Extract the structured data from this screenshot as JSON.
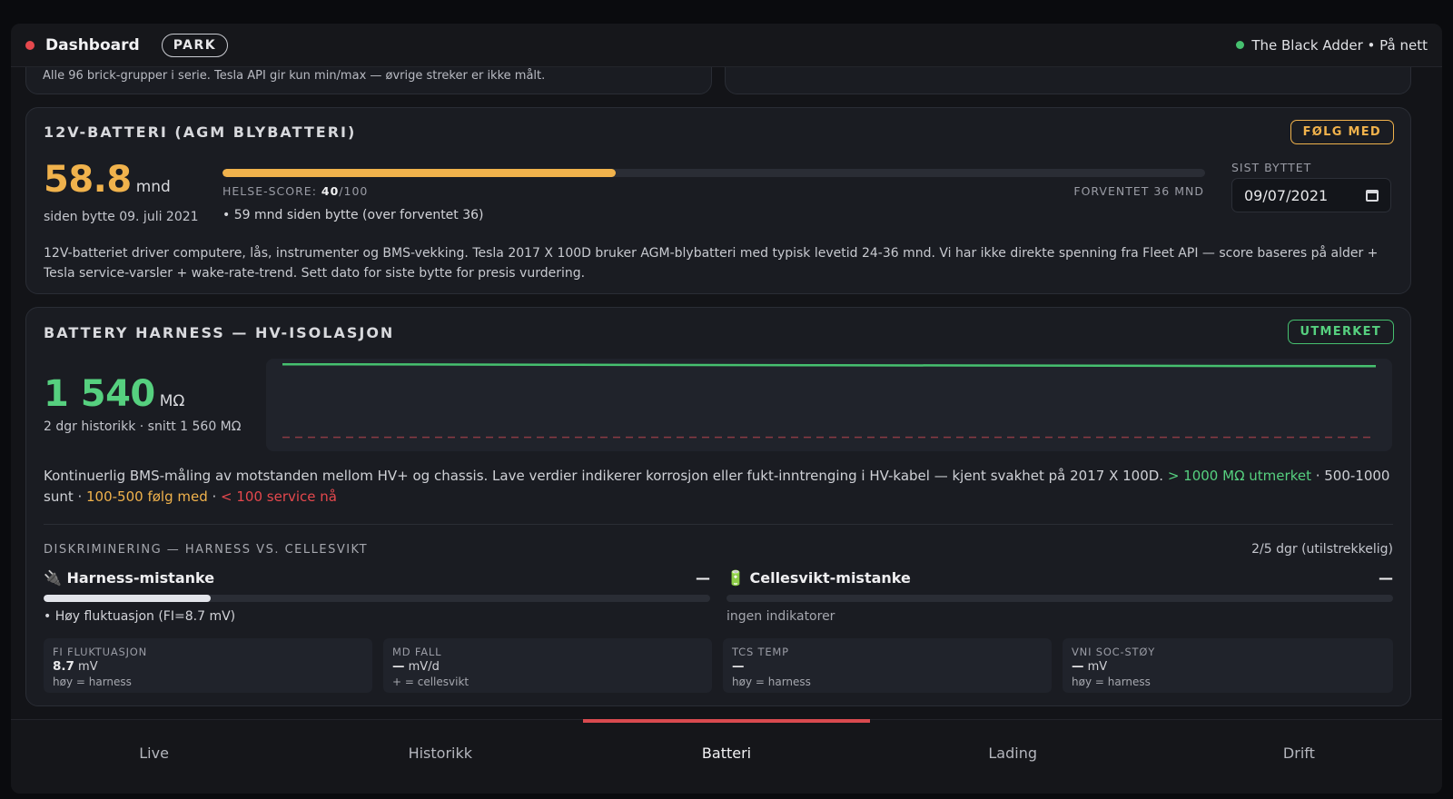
{
  "topbar": {
    "title": "Dashboard",
    "mode_badge": "PARK",
    "vehicle_status": "The Black Adder • På nett"
  },
  "cells_card": {
    "note": "Alle 96 brick-grupper i serie. Tesla API gir kun min/max — øvrige streker er ikke målt."
  },
  "battery12v": {
    "title": "12V-BATTERI (AGM BLYBATTERI)",
    "status_badge": "FØLG MED",
    "age_value": "58.8",
    "age_unit": "mnd",
    "since_label": "siden bytte 09. juli 2021",
    "health_label": "HELSE-SCORE: ",
    "health_score": "40",
    "health_max": "/100",
    "health_fraction": 0.4,
    "expected_label": "FORVENTET 36 MND",
    "bullet": "• 59 mnd siden bytte (over forventet 36)",
    "last_changed_label": "SIST BYTTET",
    "last_changed_value": "09/07/2021",
    "description": "12V-batteriet driver computere, lås, instrumenter og BMS-vekking. Tesla 2017 X 100D bruker AGM-blybatteri med typisk levetid 24-36 mnd. Vi har ikke direkte spenning fra Fleet API — score baseres på alder + Tesla service-varsler + wake-rate-trend. Sett dato for siste bytte for presis vurdering."
  },
  "harness": {
    "title": "BATTERY HARNESS — HV-ISOLASJON",
    "status_badge": "UTMERKET",
    "value": "1 540",
    "unit": "MΩ",
    "history_label": "2 dgr historikk · snitt 1 560 MΩ",
    "description_main": "Kontinuerlig BMS-måling av motstanden mellom HV+ og chassis. Lave verdier indikerer korrosjon eller fukt-inntrenging i HV-kabel — kjent svakhet på 2017 X 100D. ",
    "legend_excellent": "> 1000 MΩ utmerket",
    "legend_sep1": " · 500-1000 sunt · ",
    "legend_watch": "100-500 følg med",
    "legend_sep2": " · ",
    "legend_service": "< 100 service nå",
    "chart_line_color": "#46c06f",
    "chart_threshold_color": "#8a3a44"
  },
  "chart_data": {
    "type": "line",
    "series": [
      {
        "values": [
          1580,
          1575,
          1570,
          1565,
          1560,
          1555,
          1550,
          1545,
          1540
        ]
      }
    ],
    "threshold": 100,
    "ylim": [
      0,
      1620
    ]
  },
  "discrimination": {
    "title": "DISKRIMINERING — HARNESS VS. CELLESVIKT",
    "days": "2/5 dgr (utilstrekkelig)",
    "harness_title": "🔌 Harness-mistanke",
    "harness_value": "—",
    "harness_fraction": 0.25,
    "harness_indicator": "• Høy fluktuasjon (FI=8.7 mV)",
    "cell_title": "🔋 Cellesvikt-mistanke",
    "cell_value": "—",
    "cell_fraction": 0,
    "cell_indicator": "ingen indikatorer",
    "metrics": [
      {
        "label": "FI FLUKTUASJON",
        "value": "8.7",
        "unit": " mV",
        "hint": "høy = harness"
      },
      {
        "label": "MD FALL",
        "value": "—",
        "unit": " mV/d",
        "hint": "+ = cellesvikt"
      },
      {
        "label": "TCS TEMP",
        "value": "—",
        "unit": "",
        "hint": "høy = harness"
      },
      {
        "label": "VNI SOC-STØY",
        "value": "—",
        "unit": " mV",
        "hint": "høy = harness"
      }
    ]
  },
  "tabs": [
    {
      "label": "Live"
    },
    {
      "label": "Historikk"
    },
    {
      "label": "Batteri",
      "active": true
    },
    {
      "label": "Lading"
    },
    {
      "label": "Drift"
    }
  ]
}
